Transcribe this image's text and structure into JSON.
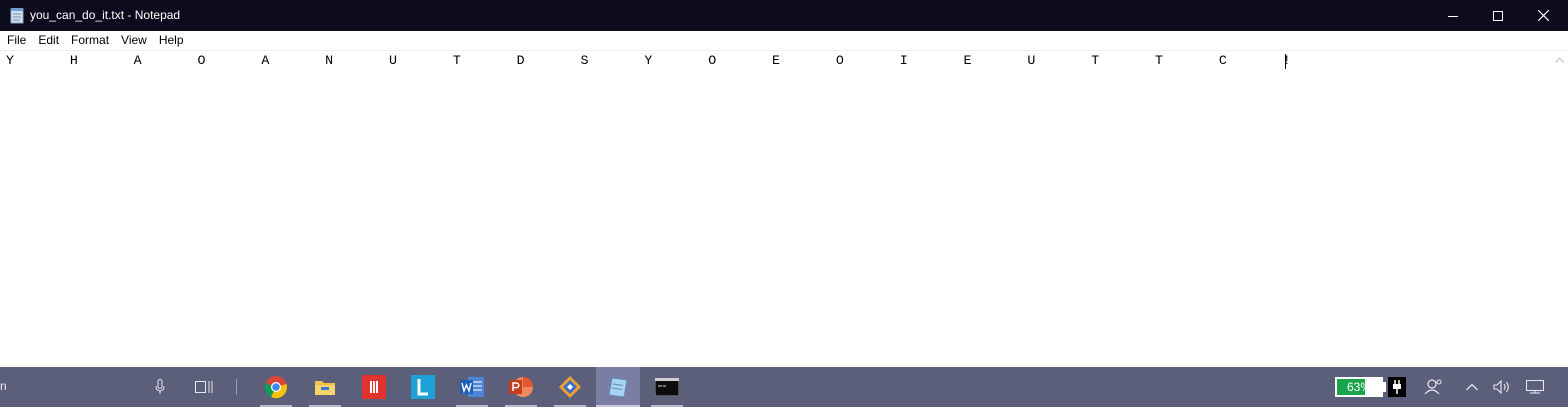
{
  "window": {
    "title": "you_can_do_it.txt - Notepad",
    "controls": {
      "minimize": "minimize",
      "maximize": "maximize",
      "close": "close"
    }
  },
  "menu": {
    "items": [
      "File",
      "Edit",
      "Format",
      "View",
      "Help"
    ]
  },
  "editor": {
    "content": "Y       H       A       O       A       N       U       T       D       S       Y       O       E       O       I       E       U       T       T       C       !"
  },
  "taskbar": {
    "search_fragment": "n",
    "battery": {
      "percent_text": "63%",
      "level": 0.63,
      "fill_color": "#19a34a"
    },
    "apps": [
      "microphone-icon",
      "task-view-icon",
      "chrome-icon",
      "file-explorer-icon",
      "red-app-icon",
      "l-app-icon",
      "word-icon",
      "powerpoint-icon",
      "tool-app-icon",
      "notepad-icon",
      "terminal-icon"
    ],
    "tray": [
      "people-icon",
      "chevron-up-icon",
      "volume-icon",
      "action-center-icon"
    ]
  },
  "colors": {
    "titlebar": "#0c0c1c",
    "taskbar": "#5c5f7a",
    "active_task": "#7a7ea3"
  }
}
